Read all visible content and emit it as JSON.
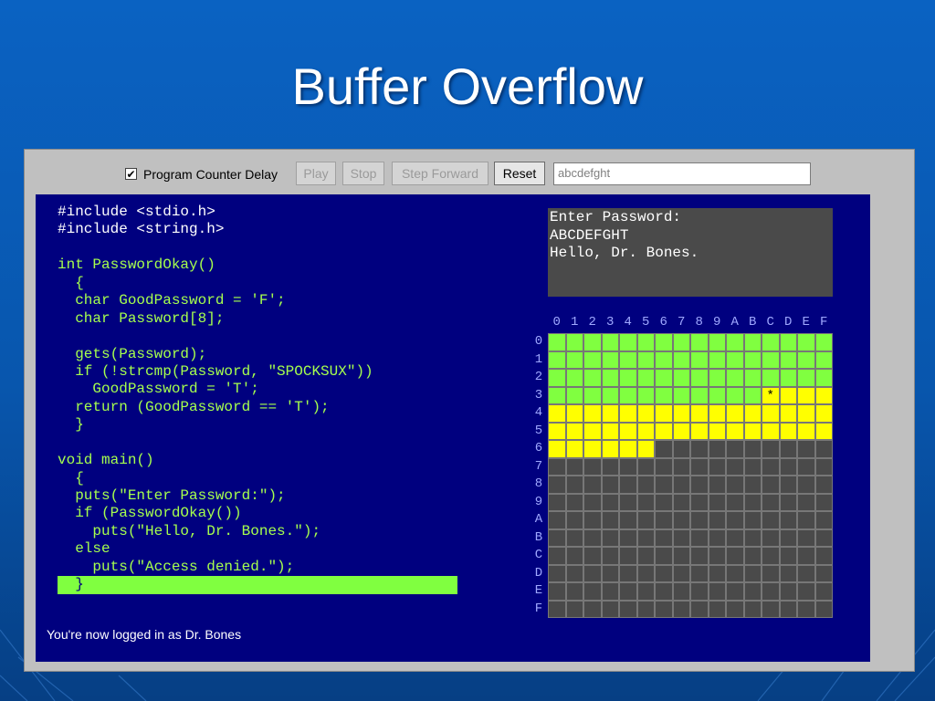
{
  "slide": {
    "title": "Buffer Overflow"
  },
  "toolbar": {
    "checkbox_label": "Program Counter Delay",
    "checkbox_checked": true,
    "play_label": "Play",
    "stop_label": "Stop",
    "step_label": "Step Forward",
    "reset_label": "Reset",
    "input_value": "abcdefght"
  },
  "code": {
    "lines": [
      "#include <stdio.h>",
      "#include <string.h>",
      "",
      "int PasswordOkay()",
      "  {",
      "  char GoodPassword = 'F';",
      "  char Password[8];",
      "",
      "  gets(Password);",
      "  if (!strcmp(Password, \"SPOCKSUX\"))",
      "    GoodPassword = 'T';",
      "  return (GoodPassword == 'T');",
      "  }",
      "",
      "void main()",
      "  {",
      "  puts(\"Enter Password:\");",
      "  if (PasswordOkay())",
      "    puts(\"Hello, Dr. Bones.\");",
      "  else",
      "    puts(\"Access denied.\");",
      "  }"
    ],
    "white_lines": [
      0,
      1
    ],
    "current_line": 21
  },
  "console": {
    "lines": [
      "Enter Password:",
      "ABCDEFGHT",
      "Hello, Dr. Bones."
    ]
  },
  "memory": {
    "col_labels": [
      "0",
      "1",
      "2",
      "3",
      "4",
      "5",
      "6",
      "7",
      "8",
      "9",
      "A",
      "B",
      "C",
      "D",
      "E",
      "F"
    ],
    "row_labels": [
      "0",
      "1",
      "2",
      "3",
      "4",
      "5",
      "6",
      "7",
      "8",
      "9",
      "A",
      "B",
      "C",
      "D",
      "E",
      "F"
    ],
    "green_cells": 60,
    "yellow_cells": 42,
    "marker": {
      "row": 3,
      "col": 12,
      "text": "*"
    },
    "colors": {
      "green": "#80ff40",
      "yellow": "#ffff00",
      "gray": "#4a4a4a"
    }
  },
  "status": {
    "text": "You're now logged in as Dr. Bones"
  }
}
